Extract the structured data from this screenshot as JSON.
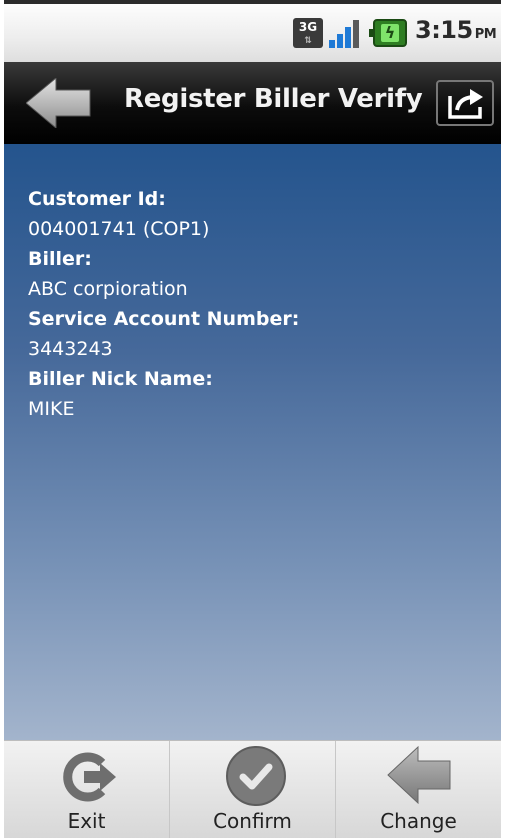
{
  "status_bar": {
    "network_type": "3G",
    "time": "3:15",
    "ampm": "PM"
  },
  "header": {
    "title": "Register Biller Verify"
  },
  "details": [
    {
      "label": "Customer Id:",
      "value": "004001741 (COP1)"
    },
    {
      "label": "Biller:",
      "value": "ABC corpioration"
    },
    {
      "label": "Service Account Number:",
      "value": "3443243"
    },
    {
      "label": "Biller Nick Name:",
      "value": "MIKE"
    }
  ],
  "bottom_bar": {
    "exit_label": "Exit",
    "confirm_label": "Confirm",
    "change_label": "Change"
  },
  "icons": {
    "back": "back-arrow-icon",
    "share": "share-icon",
    "exit": "exit-icon",
    "confirm": "checkmark-icon",
    "change": "back-arrow-icon"
  },
  "colors": {
    "content_top": "#24548d",
    "content_bottom": "#a3b4cc",
    "titlebar": "#000000"
  }
}
